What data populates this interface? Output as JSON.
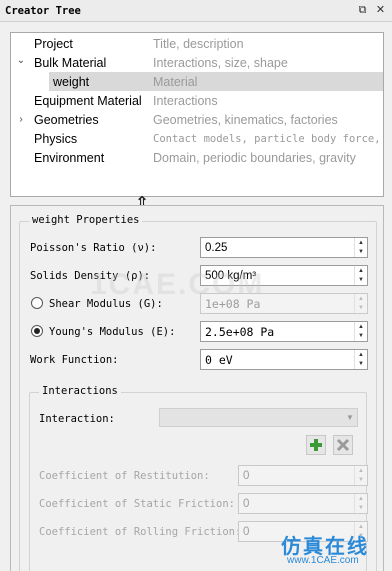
{
  "window": {
    "title": "Creator Tree",
    "float_glyph": "⧉",
    "close_glyph": "✕"
  },
  "tree": {
    "rows": [
      {
        "name": "Project",
        "desc": "Title, description",
        "expanded": null
      },
      {
        "name": "Bulk Material",
        "desc": "Interactions, size, shape",
        "expanded": true
      },
      {
        "name": "weight",
        "desc": "Material",
        "expanded": null,
        "selected": true
      },
      {
        "name": "Equipment Material",
        "desc": "Interactions",
        "expanded": null
      },
      {
        "name": "Geometries",
        "desc": "Geometries, kinematics, factories",
        "expanded": false
      },
      {
        "name": "Physics",
        "desc": "Contact models, particle body force,…",
        "expanded": null
      },
      {
        "name": "Environment",
        "desc": "Domain, periodic boundaries, gravity",
        "expanded": null
      }
    ],
    "expanded_glyph": "⌄",
    "collapsed_glyph": "›"
  },
  "splitter_glyph": "⇕",
  "properties": {
    "group_title": "weight Properties",
    "poisson_label": "Poisson's Ratio (ν):",
    "poisson_value": "0.25",
    "density_label": "Solids Density (ρ):",
    "density_value": "500 kg/m³",
    "shear_label": "Shear Modulus (G):",
    "shear_value": "1e+08 Pa",
    "shear_selected": false,
    "young_label": "Young's Modulus (E):",
    "young_value": "2.5e+08 Pa",
    "young_selected": true,
    "work_label": "Work Function:",
    "work_value": "0 eV"
  },
  "interactions": {
    "group_title": "Interactions",
    "interaction_label": "Interaction:",
    "interaction_value": "",
    "add_icon": "plus-icon",
    "remove_icon": "remove-icon",
    "restitution_label": "Coefficient of Restitution:",
    "restitution_value": "0",
    "static_label": "Coefficient of Static Friction:",
    "static_value": "0",
    "rolling_label": "Coefficient of Rolling Friction:",
    "rolling_value": "0"
  },
  "watermark": {
    "center": "1CAE.COM",
    "cn": "仿真在线",
    "url": "www.1CAE.com"
  },
  "colors": {
    "add_green": "#3a9a35",
    "remove_gray": "#9a9a9a",
    "selection": "#d9d9d9"
  }
}
